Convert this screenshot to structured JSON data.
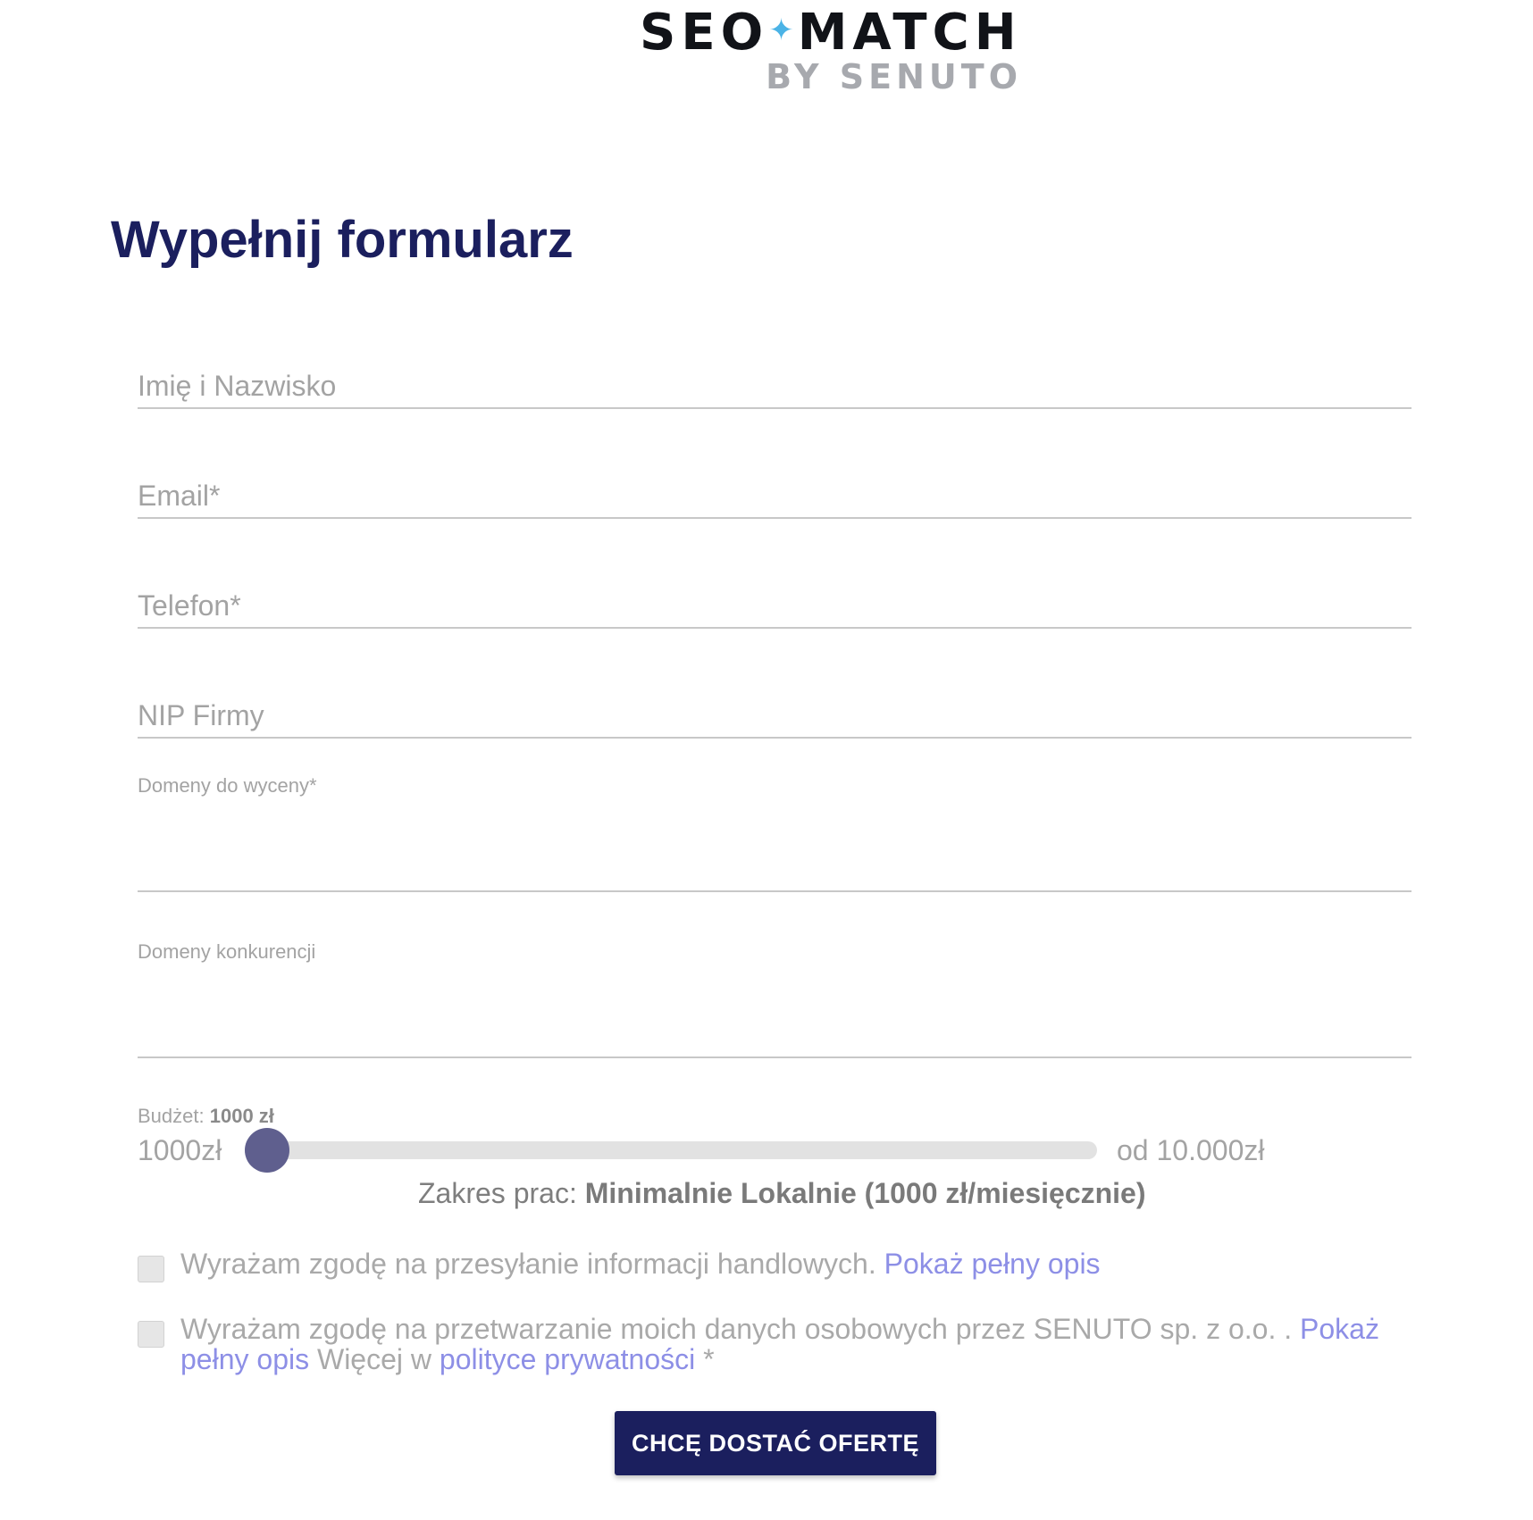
{
  "logo": {
    "main_left": "SEO",
    "main_star": "✦",
    "main_right": "MATCH",
    "sub": "BY SENUTO"
  },
  "page_title": "Wypełnij formularz",
  "form": {
    "name_placeholder": "Imię i Nazwisko",
    "email_placeholder": "Email*",
    "phone_placeholder": "Telefon*",
    "nip_placeholder": "NIP Firmy",
    "domains_label": "Domeny do wyceny*",
    "competitors_label": "Domeny konkurencji"
  },
  "budget": {
    "label_prefix": "Budżet:",
    "current_value": "1000 zł",
    "range_min_label": "1000zł",
    "range_max_label": "od 10.000zł",
    "slider_fraction": 0.0,
    "scope_prefix": "Zakres prac:",
    "scope_value": "Minimalnie Lokalnie (1000 zł/miesięcznie)"
  },
  "consents": {
    "marketing_text": "Wyrażam zgodę na przesyłanie informacji handlowych.",
    "marketing_link": "Pokaż pełny opis",
    "processing_text": "Wyrażam zgodę na przetwarzanie moich danych osobowych przez SENUTO sp. z o.o. .",
    "processing_link": "Pokaż pełny opis",
    "processing_more": "Więcej w",
    "privacy_link": "polityce prywatności",
    "required_mark": "*"
  },
  "submit_label": "CHCĘ DOSTAĆ OFERTĘ",
  "colors": {
    "brand_navy": "#1b1f5e",
    "star_blue": "#4bb3e6",
    "link": "#8d8fe6",
    "slider_thumb": "#5f5f8e"
  }
}
